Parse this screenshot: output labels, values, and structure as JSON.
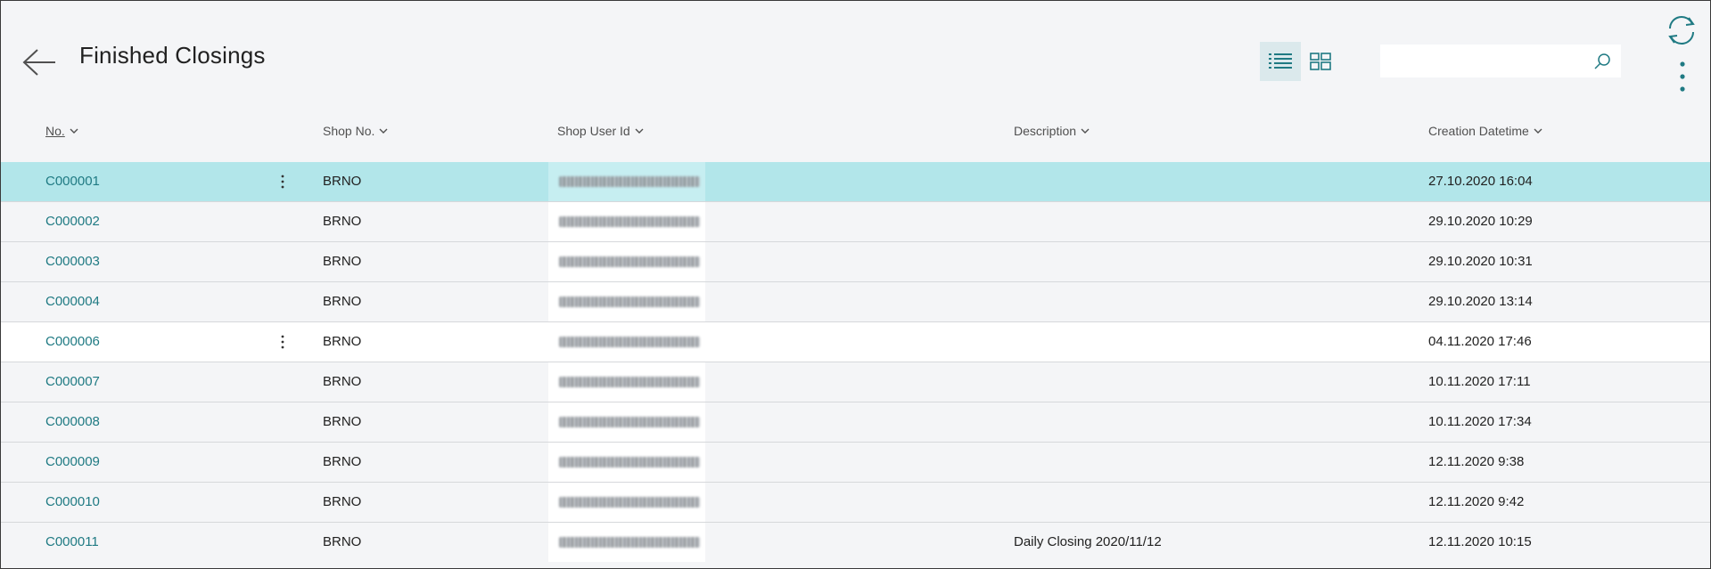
{
  "header": {
    "title": "Finished Closings",
    "back_icon": "arrow-left-icon",
    "list_view_icon": "list-view-icon",
    "tile_view_icon": "tile-view-icon",
    "search": {
      "value": "",
      "placeholder": ""
    },
    "refresh_icon": "refresh-icon",
    "more_icon": "more-vertical-icon"
  },
  "columns": {
    "no": "No.",
    "shop_no": "Shop No.",
    "shop_user_id": "Shop User Id",
    "description": "Description",
    "creation_datetime": "Creation Datetime"
  },
  "rows": [
    {
      "no": "C000001",
      "shop_no": "BRNO",
      "description": "",
      "creation_datetime": "27.10.2020 16:04",
      "selected": true,
      "menu": true
    },
    {
      "no": "C000002",
      "shop_no": "BRNO",
      "description": "",
      "creation_datetime": "29.10.2020 10:29"
    },
    {
      "no": "C000003",
      "shop_no": "BRNO",
      "description": "",
      "creation_datetime": "29.10.2020 10:31"
    },
    {
      "no": "C000004",
      "shop_no": "BRNO",
      "description": "",
      "creation_datetime": "29.10.2020 13:14"
    },
    {
      "no": "C000006",
      "shop_no": "BRNO",
      "description": "",
      "creation_datetime": "04.11.2020 17:46",
      "hovered": true,
      "menu": true
    },
    {
      "no": "C000007",
      "shop_no": "BRNO",
      "description": "",
      "creation_datetime": "10.11.2020 17:11"
    },
    {
      "no": "C000008",
      "shop_no": "BRNO",
      "description": "",
      "creation_datetime": "10.11.2020 17:34"
    },
    {
      "no": "C000009",
      "shop_no": "BRNO",
      "description": "",
      "creation_datetime": "12.11.2020 9:38"
    },
    {
      "no": "C000010",
      "shop_no": "BRNO",
      "description": "",
      "creation_datetime": "12.11.2020 9:42"
    },
    {
      "no": "C000011",
      "shop_no": "BRNO",
      "description": "Daily Closing 2020/11/12",
      "creation_datetime": "12.11.2020 10:15"
    }
  ],
  "colors": {
    "accent": "#1f7a83",
    "selected_row": "#b2e6ea",
    "background": "#f4f5f7"
  }
}
